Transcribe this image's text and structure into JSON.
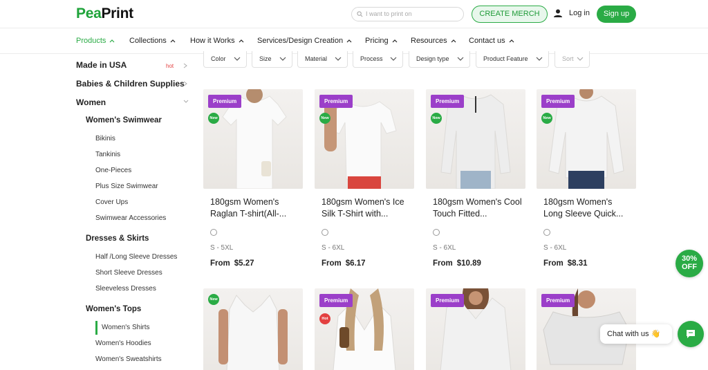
{
  "header": {
    "logo_a": "Pea",
    "logo_b": "Print",
    "search_placeholder": "I want to print on",
    "create_label": "CREATE MERCH",
    "login_label": "Log in",
    "signup_label": "Sign up"
  },
  "nav": {
    "items": [
      "Products",
      "Collections",
      "How it Works",
      "Services/Design Creation",
      "Pricing",
      "Resources",
      "Contact us"
    ]
  },
  "sidebar": {
    "made_in_usa": "Made in USA",
    "hot": "hot",
    "babies": "Babies & Children Supplies",
    "women": "Women",
    "swimwear": "Women's Swimwear",
    "bikinis": "Bikinis",
    "tankinis": "Tankinis",
    "one_pieces": "One-Pieces",
    "plus_size": "Plus Size Swimwear",
    "cover_ups": "Cover Ups",
    "swim_acc": "Swimwear Accessories",
    "dresses": "Dresses & Skirts",
    "half_long": "Half /Long Sleeve Dresses",
    "short_sleeve": "Short Sleeve Dresses",
    "sleeveless": "Sleeveless Dresses",
    "tops": "Women's Tops",
    "shirts": "Women's Shirts",
    "hoodies": "Women's Hoodies",
    "sweatshirts": "Women's Sweatshirts"
  },
  "filters": [
    "Color",
    "Size",
    "Material",
    "Process",
    "Design type",
    "Product Feature",
    "Sort"
  ],
  "products": [
    {
      "badge": "Premium",
      "new": "New",
      "title": "180gsm Women's Raglan T-shirt(All-...",
      "size": "S - 5XL",
      "from": "From",
      "price": "$5.27"
    },
    {
      "badge": "Premium",
      "new": "New",
      "title": "180gsm Women's Ice Silk T-Shirt with...",
      "size": "S - 6XL",
      "from": "From",
      "price": "$6.17"
    },
    {
      "badge": "Premium",
      "new": "New",
      "title": "180gsm Women's Cool Touch Fitted...",
      "size": "S - 6XL",
      "from": "From",
      "price": "$10.89"
    },
    {
      "badge": "Premium",
      "new": "New",
      "title": "180gsm Women's Long Sleeve Quick...",
      "size": "S - 6XL",
      "from": "From",
      "price": "$8.31"
    }
  ],
  "products_row2": [
    {
      "new": "New"
    },
    {
      "badge": "Premium",
      "hot": "Hot"
    },
    {
      "badge": "Premium"
    },
    {
      "badge": "Premium"
    }
  ],
  "promo": {
    "line1": "30%",
    "line2": "OFF"
  },
  "chat": {
    "label": "Chat with us 👋"
  },
  "colors": {
    "brand_green": "#2aab45",
    "premium_purple": "#9b3fc9",
    "hot_red": "#e34040"
  }
}
